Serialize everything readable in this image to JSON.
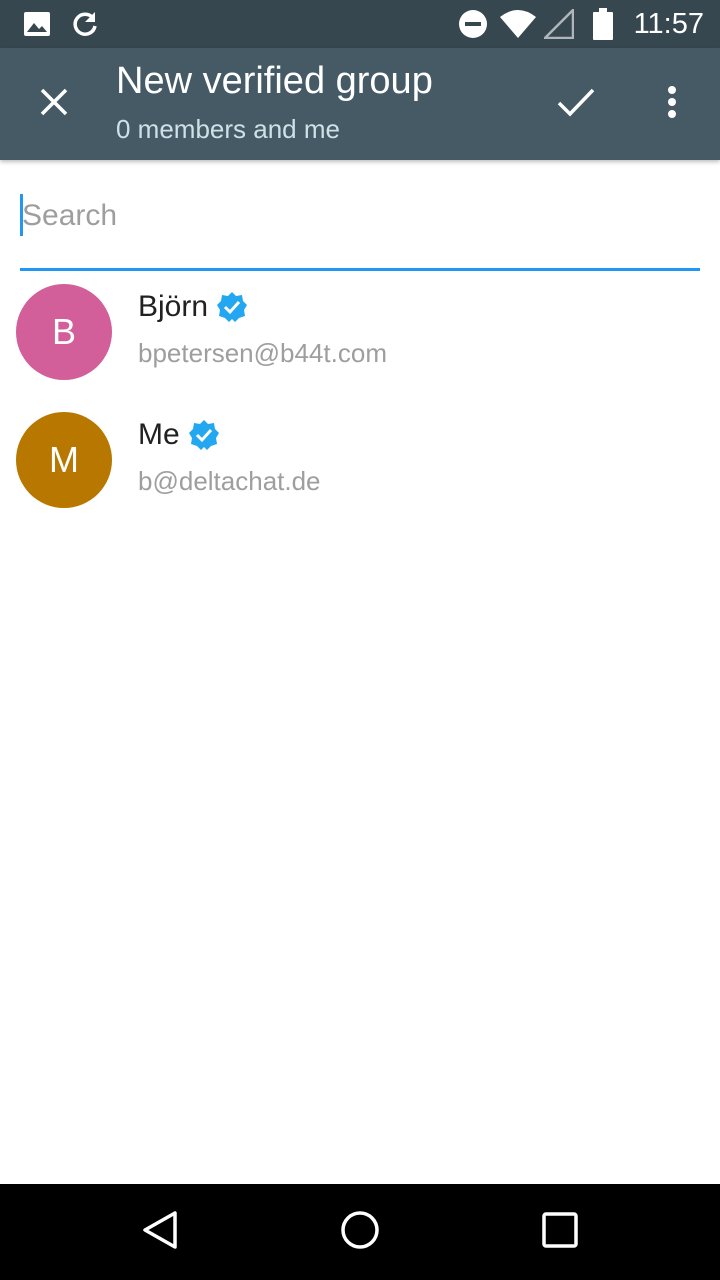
{
  "status_bar": {
    "time": "11:57",
    "icons_left": [
      "image-icon",
      "sync-icon"
    ],
    "icons_right": [
      "do-not-disturb-icon",
      "wifi-icon",
      "cell-signal-icon",
      "battery-icon"
    ]
  },
  "toolbar": {
    "title": "New verified group",
    "subtitle": "0 members and me",
    "close_icon": "close-icon",
    "confirm_icon": "check-icon",
    "menu_icon": "more-vert-icon",
    "background": "#455a64"
  },
  "search": {
    "placeholder": "Search",
    "value": "",
    "accent": "#2196f3"
  },
  "contacts": [
    {
      "initial": "B",
      "name": "Björn",
      "address": "bpetersen@b44t.com",
      "avatar_color": "#d25f9a",
      "verified": true
    },
    {
      "initial": "M",
      "name": "Me",
      "address": "b@deltachat.de",
      "avatar_color": "#b87800",
      "verified": true
    }
  ],
  "nav_bar": {
    "buttons": [
      "back-icon",
      "home-icon",
      "recents-icon"
    ]
  },
  "colors": {
    "status_bar": "#37474f",
    "verified_badge": "#22a7f0"
  }
}
